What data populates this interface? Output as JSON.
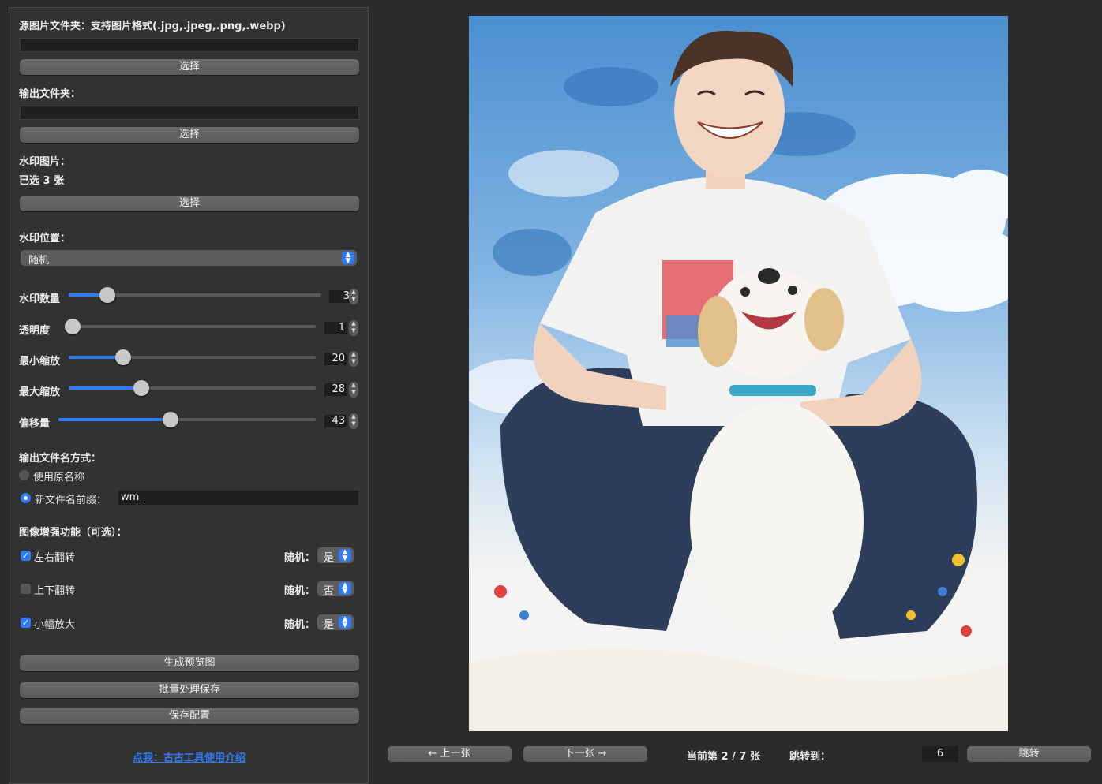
{
  "source": {
    "label": "源图片文件夹：支持图片格式(.jpg,.jpeg,.png,.webp)",
    "path_value": "",
    "choose_label": "选择"
  },
  "output": {
    "label": "输出文件夹：",
    "path_value": "",
    "choose_label": "选择"
  },
  "watermark_image": {
    "label": "水印图片：",
    "selected_text": "已选 3 张",
    "choose_label": "选择"
  },
  "position": {
    "label": "水印位置：",
    "selected": "随机"
  },
  "sliders": [
    {
      "label": "水印数量",
      "value": "3",
      "fraction": 0.13
    },
    {
      "label": "透明度",
      "value": "1",
      "fraction": 0.0
    },
    {
      "label": "最小缩放",
      "value": "20",
      "fraction": 0.2
    },
    {
      "label": "最大缩放",
      "value": "28",
      "fraction": 0.28
    },
    {
      "label": "偏移量",
      "value": "43",
      "fraction": 0.43
    }
  ],
  "filename": {
    "label": "输出文件名方式：",
    "option_original": "使用原名称",
    "option_prefix": "新文件名前缀：",
    "prefix_value": "wm_",
    "selected": "prefix"
  },
  "enhance": {
    "label": "图像增强功能（可选）：",
    "random_label": "随机：",
    "items": [
      {
        "label": "左右翻转",
        "checked": true,
        "random": "是"
      },
      {
        "label": "上下翻转",
        "checked": false,
        "random": "否"
      },
      {
        "label": "小幅放大",
        "checked": true,
        "random": "是"
      }
    ]
  },
  "actions": {
    "preview": "生成预览图",
    "batch": "批量处理保存",
    "save_config": "保存配置"
  },
  "help_link": "点我：古古工具使用介绍",
  "nav": {
    "prev": "← 上一张",
    "next": "下一张 →",
    "status": "当前第 2 / 7 张",
    "jump_label": "跳转到：",
    "jump_value": "6",
    "jump_button": "跳转"
  },
  "colors": {
    "accent": "#2f7bf5",
    "panel_bg": "#323232",
    "window_bg": "#2b2b2b"
  }
}
